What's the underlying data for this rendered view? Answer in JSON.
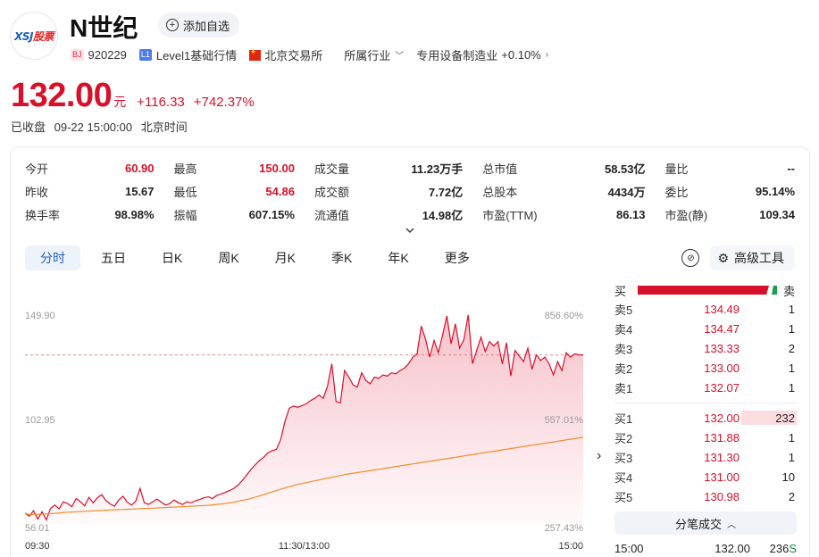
{
  "header": {
    "logo_text": "XSJ",
    "logo_sub": "股票",
    "name": "N世纪",
    "add_watch_label": "添加自选",
    "exchange_tag": "BJ",
    "code": "920229",
    "level_tag": "L1",
    "level_label": "Level1基础行情",
    "exchange_name": "北京交易所",
    "industry_label": "所属行业",
    "industry_name": "专用设备制造业",
    "industry_change": "+0.10%"
  },
  "quote": {
    "price": "132.00",
    "unit": "元",
    "change": "+116.33",
    "change_pct": "+742.37%",
    "status": "已收盘",
    "time": "09-22 15:00:00",
    "tz": "北京时间"
  },
  "stats": [
    [
      {
        "l": "今开",
        "v": "60.90",
        "c": "red"
      },
      {
        "l": "最高",
        "v": "150.00",
        "c": "red"
      },
      {
        "l": "成交量",
        "v": "11.23万手",
        "c": ""
      },
      {
        "l": "总市值",
        "v": "58.53亿",
        "c": ""
      },
      {
        "l": "量比",
        "v": "--",
        "c": ""
      }
    ],
    [
      {
        "l": "昨收",
        "v": "15.67",
        "c": ""
      },
      {
        "l": "最低",
        "v": "54.86",
        "c": "red"
      },
      {
        "l": "成交额",
        "v": "7.72亿",
        "c": ""
      },
      {
        "l": "总股本",
        "v": "4434万",
        "c": ""
      },
      {
        "l": "委比",
        "v": "95.14%",
        "c": ""
      }
    ],
    [
      {
        "l": "换手率",
        "v": "98.98%",
        "c": ""
      },
      {
        "l": "振幅",
        "v": "607.15%",
        "c": ""
      },
      {
        "l": "流通值",
        "v": "14.98亿",
        "c": ""
      },
      {
        "l": "市盈(TTM)",
        "v": "86.13",
        "c": ""
      },
      {
        "l": "市盈(静)",
        "v": "109.34",
        "c": ""
      }
    ]
  ],
  "tabs": [
    "分时",
    "五日",
    "日K",
    "周K",
    "月K",
    "季K",
    "年K",
    "更多"
  ],
  "active_tab": 0,
  "tools": {
    "advanced_label": "高级工具"
  },
  "colors": {
    "up": "#d8102a",
    "down": "#0a8a43",
    "avg_line": "#f08c28",
    "accent": "#1e5fb4"
  },
  "chart_data": {
    "type": "line",
    "title": "",
    "x_labels": [
      "09:30",
      "11:30/13:00",
      "15:00"
    ],
    "y_left_labels": [
      "149.90",
      "102.95",
      "56.01"
    ],
    "y_right_labels": [
      "856.60%",
      "557.01%",
      "257.43%"
    ],
    "ylim": [
      56.01,
      149.9
    ],
    "prev_close": 15.67,
    "reference_price": 132.0,
    "series": [
      {
        "values": [
          60.9,
          59.5,
          62.0,
          58.2,
          61.5,
          57.8,
          63.0,
          64.5,
          62.8,
          66.0,
          65.2,
          63.8,
          67.5,
          66.0,
          64.2,
          68.0,
          65.5,
          67.8,
          69.2,
          66.5,
          65.0,
          64.0,
          66.8,
          68.5,
          65.8,
          64.5,
          66.2,
          72.0,
          65.5,
          64.8,
          66.0,
          67.2,
          65.8,
          64.5,
          65.2,
          66.8,
          65.5,
          64.8,
          66.0,
          65.5,
          66.5,
          67.0,
          67.8,
          68.2,
          67.5,
          68.8,
          69.5,
          70.2,
          71.0,
          72.0,
          73.5,
          75.5,
          78.0,
          80.5,
          82.5,
          84.5,
          86.0,
          88.0,
          89.0,
          89.5,
          94.0,
          102.0,
          108.0,
          109.0,
          108.5,
          109.2,
          110.0,
          111.5,
          112.5,
          114.0,
          112.5,
          118.0,
          128.0,
          111.0,
          110.5,
          125.0,
          122.0,
          118.5,
          117.5,
          124.0,
          120.5,
          119.0,
          122.0,
          121.5,
          123.0,
          122.5,
          124.0,
          123.5,
          125.0,
          126.0,
          128.0,
          131.0,
          132.5,
          145.0,
          139.0,
          131.0,
          138.5,
          133.0,
          141.0,
          149.5,
          137.0,
          146.0,
          135.0,
          139.0,
          150.0,
          128.0,
          134.0,
          140.0,
          133.5,
          138.0,
          136.0,
          138.0,
          128.0,
          137.5,
          122.5,
          134.0,
          131.5,
          129.0,
          135.0,
          125.5,
          132.0,
          129.5,
          131.0,
          128.0,
          123.0,
          129.0,
          125.0,
          133.0,
          131.0,
          132.5,
          132.0,
          132.0
        ]
      },
      {
        "values": [
          60.9,
          60.2,
          60.3,
          60.4,
          60.5,
          60.6,
          60.7,
          60.8,
          61.0,
          61.2,
          61.3,
          61.4,
          61.5,
          61.6,
          61.7,
          61.8,
          61.9,
          62.0,
          62.1,
          62.2,
          62.3,
          62.4,
          62.5,
          62.5,
          62.6,
          62.7,
          62.8,
          62.9,
          63.0,
          63.0,
          63.1,
          63.2,
          63.3,
          63.4,
          63.5,
          63.6,
          63.7,
          63.8,
          63.9,
          64.0,
          64.1,
          64.2,
          64.3,
          64.4,
          64.6,
          64.8,
          65.0,
          65.2,
          65.5,
          65.8,
          66.2,
          66.6,
          67.0,
          67.5,
          68.0,
          68.6,
          69.2,
          69.8,
          70.4,
          71.0,
          71.6,
          72.2,
          72.8,
          73.3,
          73.8,
          74.2,
          74.6,
          75.0,
          75.4,
          75.8,
          76.2,
          76.6,
          77.0,
          77.4,
          77.8,
          78.2,
          78.5,
          78.8,
          79.1,
          79.4,
          79.7,
          80.0,
          80.3,
          80.6,
          80.9,
          81.2,
          81.5,
          81.8,
          82.1,
          82.4,
          82.7,
          83.0,
          83.3,
          83.6,
          83.9,
          84.2,
          84.5,
          84.8,
          85.1,
          85.4,
          85.7,
          86.0,
          86.3,
          86.6,
          86.9,
          87.2,
          87.5,
          87.8,
          88.1,
          88.4,
          88.7,
          89.0,
          89.3,
          89.6,
          89.9,
          90.2,
          90.5,
          90.8,
          91.1,
          91.4,
          91.7,
          92.0,
          92.3,
          92.6,
          92.9,
          93.2,
          93.5,
          93.8,
          94.1,
          94.4,
          94.7,
          95.0
        ]
      }
    ]
  },
  "order_book": {
    "buy_label": "买",
    "sell_label": "卖",
    "buy_ratio": 0.95,
    "sells": [
      {
        "k": "卖5",
        "p": "134.49",
        "v": "1"
      },
      {
        "k": "卖4",
        "p": "134.47",
        "v": "1"
      },
      {
        "k": "卖3",
        "p": "133.33",
        "v": "2"
      },
      {
        "k": "卖2",
        "p": "133.00",
        "v": "1"
      },
      {
        "k": "卖1",
        "p": "132.07",
        "v": "1"
      }
    ],
    "buys": [
      {
        "k": "买1",
        "p": "132.00",
        "v": "232",
        "vol": 232
      },
      {
        "k": "买2",
        "p": "131.88",
        "v": "1",
        "vol": 1
      },
      {
        "k": "买3",
        "p": "131.30",
        "v": "1",
        "vol": 1
      },
      {
        "k": "买4",
        "p": "131.00",
        "v": "10",
        "vol": 10
      },
      {
        "k": "买5",
        "p": "130.98",
        "v": "2",
        "vol": 2
      }
    ],
    "trades_label": "分笔成交",
    "last_trade": {
      "t": "15:00",
      "p": "132.00",
      "v": "236",
      "side": "S"
    }
  }
}
